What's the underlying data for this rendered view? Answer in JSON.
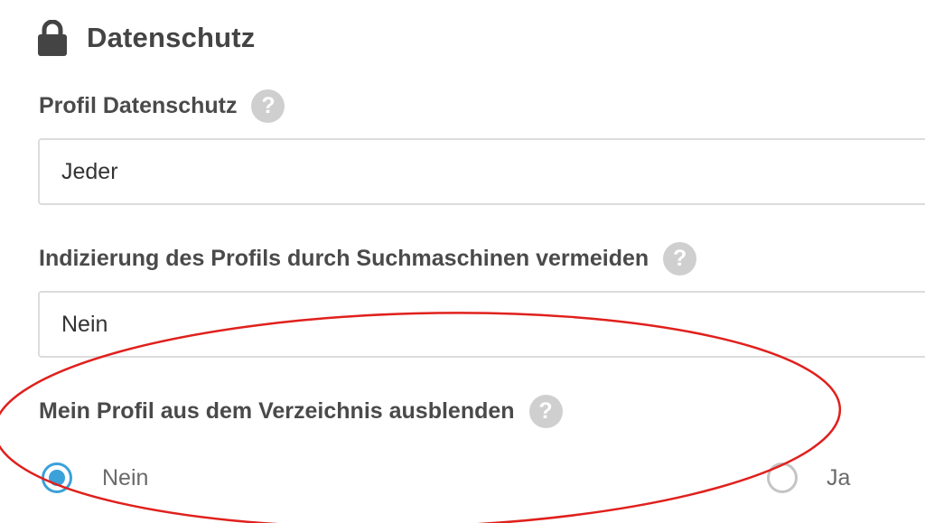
{
  "section": {
    "icon": "lock-icon",
    "title": "Datenschutz"
  },
  "fields": {
    "profile_privacy": {
      "label": "Profil Datenschutz",
      "value": "Jeder",
      "help_icon": "question-icon",
      "help_glyph": "?"
    },
    "search_indexing": {
      "label": "Indizierung des Profils durch Suchmaschinen vermeiden",
      "value": "Nein",
      "help_icon": "question-icon",
      "help_glyph": "?"
    },
    "hide_from_directory": {
      "label": "Mein Profil aus dem Verzeichnis ausblenden",
      "help_icon": "question-icon",
      "help_glyph": "?",
      "options": [
        {
          "label": "Nein",
          "selected": true
        },
        {
          "label": "Ja",
          "selected": false
        }
      ]
    }
  },
  "colors": {
    "accent": "#3ba1da",
    "annotation": "#e0201c",
    "text": "#444444",
    "help_icon_bg": "#cfcfcf"
  }
}
